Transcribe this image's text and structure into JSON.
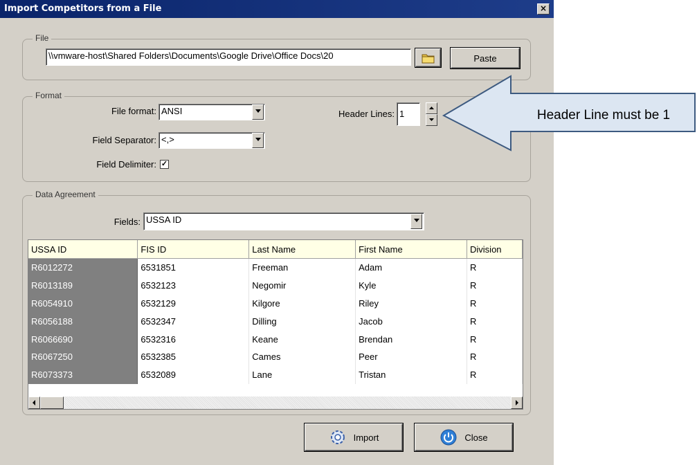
{
  "dialog": {
    "title": "Import Competitors from a File",
    "close_glyph": "×"
  },
  "file_group": {
    "legend": "File",
    "path_value": "\\\\vmware-host\\Shared Folders\\Documents\\Google Drive\\Office Docs\\20",
    "paste_label": "Paste"
  },
  "format_group": {
    "legend": "Format",
    "file_format_label": "File format:",
    "file_format_value": "ANSI",
    "separator_label": "Field Separator:",
    "separator_value": "<,>",
    "delimiter_label": "Field Delimiter:",
    "delimiter_checked": true,
    "header_lines_label": "Header Lines:",
    "header_lines_value": "1"
  },
  "data_group": {
    "legend": "Data Agreement",
    "fields_label": "Fields:",
    "fields_value": "USSA ID",
    "columns": [
      "USSA ID",
      "FIS ID",
      "Last Name",
      "First Name",
      "Division"
    ],
    "rows": [
      [
        "R6012272",
        "6531851",
        "Freeman",
        "Adam",
        "R"
      ],
      [
        "R6013189",
        "6532123",
        "Negomir",
        "Kyle",
        "R"
      ],
      [
        "R6054910",
        "6532129",
        "Kilgore",
        "Riley",
        "R"
      ],
      [
        "R6056188",
        "6532347",
        "Dilling",
        "Jacob",
        "R"
      ],
      [
        "R6066690",
        "6532316",
        "Keane",
        "Brendan",
        "R"
      ],
      [
        "R6067250",
        "6532385",
        "Cames",
        "Peer",
        "R"
      ],
      [
        "R6073373",
        "6532089",
        "Lane",
        "Tristan",
        "R"
      ]
    ]
  },
  "buttons": {
    "import_label": "Import",
    "close_label": "Close"
  },
  "annotation": {
    "text": "Header Line must be 1"
  },
  "colors": {
    "titlebar": "#0a246a",
    "dialog_bg": "#d4d0c8",
    "callout_fill": "#dce6f2",
    "callout_stroke": "#3d5a80"
  }
}
